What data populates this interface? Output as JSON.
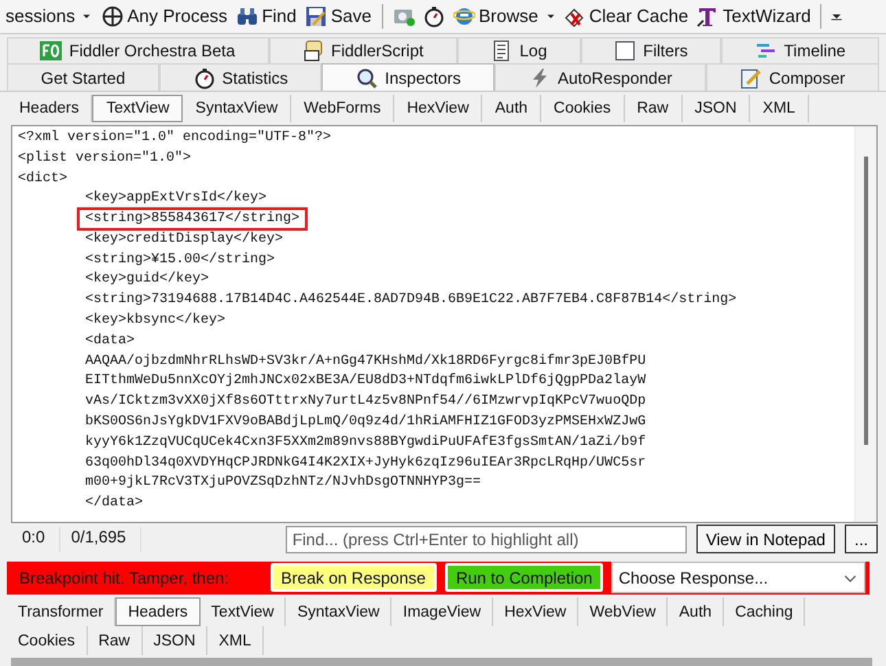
{
  "toolbar": [
    {
      "kind": "dropdown",
      "label": "sessions"
    },
    {
      "kind": "target",
      "label": "Any Process"
    },
    {
      "kind": "find",
      "label": "Find"
    },
    {
      "kind": "save",
      "label": "Save"
    },
    {
      "kind": "camera"
    },
    {
      "kind": "timer"
    },
    {
      "kind": "browser",
      "label": "Browse"
    },
    {
      "kind": "clear",
      "label": "Clear Cache"
    },
    {
      "kind": "textwizard",
      "label": "TextWizard"
    }
  ],
  "tabs_row_1": [
    {
      "label": "Fiddler Orchestra Beta",
      "selected": false
    },
    {
      "label": "FiddlerScript",
      "selected": false
    },
    {
      "label": "Log",
      "selected": false
    },
    {
      "label": "Filters",
      "selected": false
    },
    {
      "label": "Timeline",
      "selected": false
    }
  ],
  "tabs_row_2": [
    {
      "label": "Get Started",
      "selected": false
    },
    {
      "label": "Statistics",
      "selected": false
    },
    {
      "label": "Inspectors",
      "selected": true
    },
    {
      "label": "AutoResponder",
      "selected": false
    },
    {
      "label": "Composer",
      "selected": false
    }
  ],
  "request_tabs": [
    {
      "label": "Headers",
      "selected": false
    },
    {
      "label": "TextView",
      "selected": true
    },
    {
      "label": "SyntaxView",
      "selected": false
    },
    {
      "label": "WebForms",
      "selected": false
    },
    {
      "label": "HexView",
      "selected": false
    },
    {
      "label": "Auth",
      "selected": false
    },
    {
      "label": "Cookies",
      "selected": false
    },
    {
      "label": "Raw",
      "selected": false
    },
    {
      "label": "JSON",
      "selected": false
    },
    {
      "label": "XML",
      "selected": false
    }
  ],
  "text_lines": [
    {
      "kind": "top",
      "text": "<?xml version=\"1.0\" encoding=\"UTF-8\"?>",
      "highlighted": false
    },
    {
      "kind": "top",
      "text": "<plist version=\"1.0\">",
      "highlighted": false
    },
    {
      "kind": "top",
      "text": "<dict>",
      "highlighted": false
    },
    {
      "kind": "inner",
      "text": "<key>appExtVrsId</key>",
      "highlighted": false
    },
    {
      "kind": "inner",
      "text": "<string>855843617</string>",
      "highlighted": true
    },
    {
      "kind": "inner",
      "text": "<key>creditDisplay</key>",
      "highlighted": false
    },
    {
      "kind": "inner",
      "text": "<string>¥15.00</string>",
      "highlighted": false
    },
    {
      "kind": "inner",
      "text": "<key>guid</key>",
      "highlighted": false
    },
    {
      "kind": "inner",
      "text": "<string>73194688.17B14D4C.A462544E.8AD7D94B.6B9E1C22.AB7F7EB4.C8F87B14</string>",
      "highlighted": false
    },
    {
      "kind": "inner",
      "text": "<key>kbsync</key>",
      "highlighted": false
    },
    {
      "kind": "inner",
      "text": "<data>",
      "highlighted": false
    },
    {
      "kind": "inner",
      "text": "AAQAA/ojbzdmNhrRLhsWD+SV3kr/A+nGg47KHshMd/Xk18RD6Fyrgc8ifmr3pEJ0BfPU",
      "highlighted": false
    },
    {
      "kind": "inner",
      "text": "EITthmWeDu5nnXcOYj2mhJNCx02xBE3A/EU8dD3+NTdqfm6iwkLPlDf6jQgpPDa2layW",
      "highlighted": false
    },
    {
      "kind": "inner",
      "text": "vAs/ICktzm3vXX0jXf8s6OTttrxNy7urtL4z5v8NPnf54//6IMzwrvpIqKPcV7wuoQDp",
      "highlighted": false
    },
    {
      "kind": "inner",
      "text": "bKS0OS6nJsYgkDV1FXV9oBABdjLpLmQ/0q9z4d/1hRiAMFHIZ1GFOD3yzPMSEHxWZJwG",
      "highlighted": false
    },
    {
      "kind": "inner",
      "text": "kyyY6k1ZzqVUCqUCek4Cxn3F5XXm2m89nvs88BYgwdiPuUFAfE3fgsSmtAN/1aZi/b9f",
      "highlighted": false
    },
    {
      "kind": "inner",
      "text": "63q00hDl34q0XVDYHqCPJRDNkG4I4K2XIX+JyHyk6zqIz96uIEAr3RpcLRqHp/UWC5sr",
      "highlighted": false
    },
    {
      "kind": "inner",
      "text": "m00+9jkL7RcV3TXjuPOVZSqDzhNTz/NJvhDsgOTNNHYP3g==",
      "highlighted": false
    },
    {
      "kind": "inner",
      "text": "</data>",
      "highlighted": false
    }
  ],
  "status": {
    "position": "0:0",
    "count": "0/1,695",
    "find_placeholder": "Find... (press Ctrl+Enter to highlight all)",
    "notepad_button": "View in Notepad",
    "more_button": "..."
  },
  "breakpoint_bar": {
    "message": "Breakpoint hit. Tamper, then:",
    "break_button": "Break on Response",
    "run_button": "Run to Completion",
    "response_dropdown": "Choose Response..."
  },
  "response_tabs": [
    {
      "label": "Transformer",
      "selected": false
    },
    {
      "label": "Headers",
      "selected": true
    },
    {
      "label": "TextView",
      "selected": false
    },
    {
      "label": "SyntaxView",
      "selected": false
    },
    {
      "label": "ImageView",
      "selected": false
    },
    {
      "label": "HexView",
      "selected": false
    },
    {
      "label": "WebView",
      "selected": false
    },
    {
      "label": "Auth",
      "selected": false
    },
    {
      "label": "Caching",
      "selected": false
    },
    {
      "label": "Cookies",
      "selected": false
    },
    {
      "label": "Raw",
      "selected": false
    },
    {
      "label": "JSON",
      "selected": false
    },
    {
      "label": "XML",
      "selected": false
    }
  ]
}
